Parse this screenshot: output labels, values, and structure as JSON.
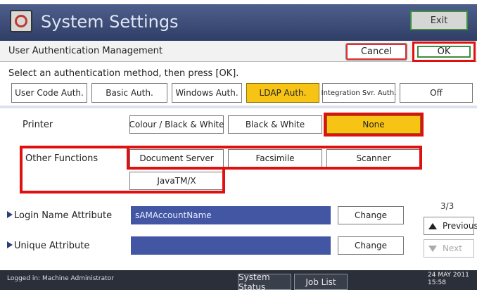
{
  "window": {
    "title": "System Settings",
    "icon": "clock-settings-icon",
    "exit_label": "Exit"
  },
  "header": {
    "title": "User Authentication Management",
    "cancel_label": "Cancel",
    "ok_label": "OK"
  },
  "instruction": "Select an authentication method, then press [OK].",
  "auth_methods": [
    {
      "label": "User Code Auth.",
      "selected": false
    },
    {
      "label": "Basic Auth.",
      "selected": false
    },
    {
      "label": "Windows Auth.",
      "selected": false
    },
    {
      "label": "LDAP Auth.",
      "selected": true
    },
    {
      "label": "Integration Svr. Auth.",
      "selected": false
    },
    {
      "label": "Off",
      "selected": false
    }
  ],
  "printer": {
    "label": "Printer",
    "options": [
      {
        "label": "Colour / Black & White",
        "selected": false
      },
      {
        "label": "Black & White",
        "selected": false
      },
      {
        "label": "None",
        "selected": true
      }
    ]
  },
  "other_functions": {
    "label": "Other Functions",
    "options": [
      {
        "label": "Document Server"
      },
      {
        "label": "Facsimile"
      },
      {
        "label": "Scanner"
      },
      {
        "label": "JavaTM/X"
      }
    ]
  },
  "attributes": [
    {
      "label": "Login Name Attribute",
      "value": "sAMAccountName",
      "change_label": "Change"
    },
    {
      "label": "Unique Attribute",
      "value": "",
      "change_label": "Change"
    }
  ],
  "pagination": {
    "page": "3/3",
    "previous_label": "Previous",
    "next_label": "Next"
  },
  "status": {
    "logged_in": "Logged in: Machine Administrator",
    "system_status_label": "System Status",
    "job_list_label": "Job List",
    "date": "24 MAY  2011",
    "time": "15:58"
  },
  "colors": {
    "accent_selected": "#f7c416",
    "highlight_red": "#e01010",
    "title_bar": "#3a4a78",
    "field_blue": "#4256a3"
  }
}
